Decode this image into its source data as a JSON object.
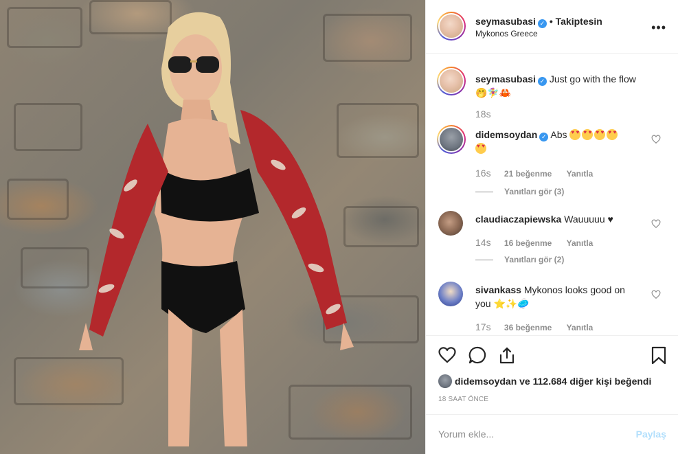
{
  "post_author": {
    "username": "seymasubasi",
    "verified_icon": "verified-badge-icon",
    "follow_status": "• Takiptesin",
    "location": "Mykonos Greece"
  },
  "caption": {
    "username": "seymasubasi",
    "text": "Just go with the flow",
    "emojis": "🤭🧚‍♀️🦀",
    "time": "18s"
  },
  "comments": [
    {
      "username": "didemsoydan",
      "verified": true,
      "text": "Abs",
      "time": "16s",
      "likes": "21 beğenme",
      "reply": "Yanıtla",
      "view_replies": "Yanıtları gör (3)"
    },
    {
      "username": "claudiaczapiewska",
      "verified": false,
      "text": "Wauuuuu ♥",
      "time": "14s",
      "likes": "16 beğenme",
      "reply": "Yanıtla",
      "view_replies": "Yanıtları gör (2)"
    },
    {
      "username": "sivankass",
      "verified": false,
      "text": "Mykonos looks good on you",
      "emojis": "⭐✨🥏",
      "time": "17s",
      "likes": "36 beğenme",
      "reply": "Yanıtla"
    }
  ],
  "likes_summary": {
    "liker": "didemsoydan",
    "rest": "ve 112.684 diğer kişi beğendi"
  },
  "timestamp": "18 SAAT ÖNCE",
  "add_comment": {
    "placeholder": "Yorum ekle...",
    "post_label": "Paylaş"
  },
  "colors": {
    "accent_blue": "#3897f0",
    "post_button_disabled": "#b2dffc",
    "muted_text": "#8e8e8e",
    "divider": "#efefef"
  },
  "icons": [
    "more-options-icon",
    "heart-icon",
    "comment-icon",
    "share-icon",
    "bookmark-icon",
    "heart-small-icon"
  ]
}
